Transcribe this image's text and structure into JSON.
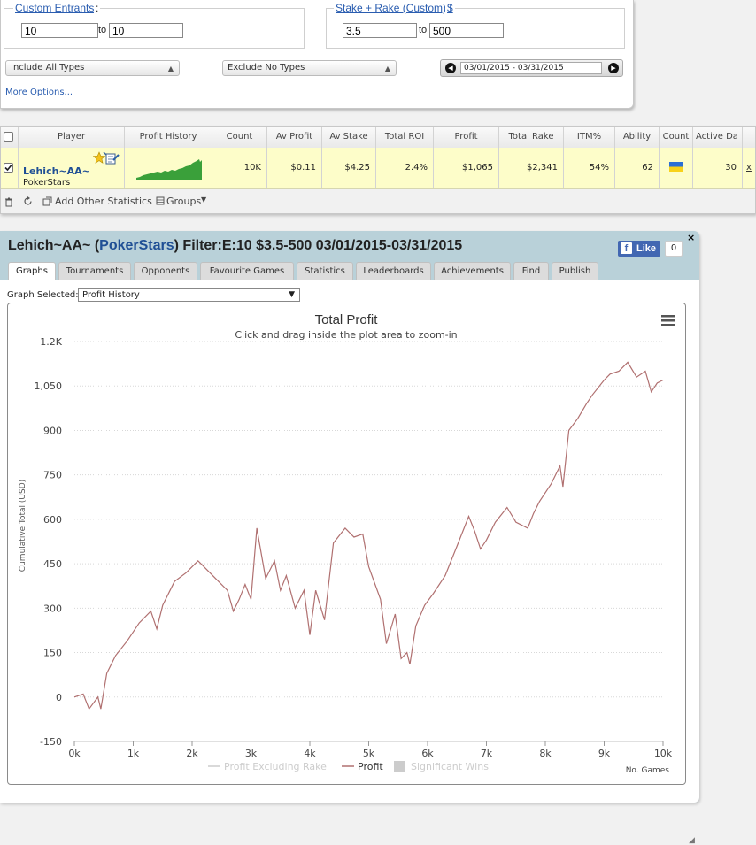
{
  "filters": {
    "entrants": {
      "legend": "Custom Entrants",
      "legend_colon": ":",
      "from": "10",
      "to_label": "to",
      "to": "10"
    },
    "stake": {
      "legend": "Stake + Rake (Custom)",
      "currency": "$",
      "from": "3.5",
      "to_label": "to",
      "to": "500"
    },
    "include_types": "Include All Types",
    "exclude_types": "Exclude No Types",
    "date_range": "03/01/2015 - 03/31/2015",
    "more_options": "More Options..."
  },
  "table": {
    "columns": [
      "Player",
      "Profit History",
      "Count",
      "Av Profit",
      "Av Stake",
      "Total ROI",
      "Profit",
      "Total Rake",
      "ITM%",
      "Ability",
      "Count",
      "Active Da"
    ],
    "row": {
      "player": "Lehich~AA~",
      "site": "PokerStars",
      "count": "10K",
      "av_profit": "$0.11",
      "av_stake": "$4.25",
      "total_roi": "2.4%",
      "profit": "$1,065",
      "total_rake": "$2,341",
      "itm": "54%",
      "ability": "62",
      "active_days": "30",
      "remove": "x"
    },
    "footer": {
      "add_stats": "Add Other Statistics",
      "groups": "Groups"
    }
  },
  "profile": {
    "player": "Lehich~AA~",
    "open_paren": "(",
    "site": "PokerStars",
    "filter_text": ") Filter:E:10 $3.5-500 03/01/2015-03/31/2015",
    "like_label": "Like",
    "like_count": "0",
    "close": "×",
    "tabs": [
      "Graphs",
      "Tournaments",
      "Opponents",
      "Favourite Games",
      "Statistics",
      "Leaderboards",
      "Achievements",
      "Find",
      "Publish"
    ],
    "active_tab": "Graphs",
    "graph_selected_label": "Graph Selected:",
    "graph_selected_value": "Profit History"
  },
  "colors": {
    "profit_line": "#b07070",
    "legend_disabled": "#cccccc",
    "link": "#1f4f95",
    "row_highlight": "#fdfdc9"
  },
  "chart_data": {
    "type": "line",
    "title": "Total Profit",
    "subtitle": "Click and drag inside the plot area to zoom-in",
    "ylabel": "Cumulative Total (USD)",
    "xlabel": "No. Games",
    "ylim": [
      -150,
      1200
    ],
    "xlim": [
      0,
      10000
    ],
    "y_ticks": [
      "-150",
      "0",
      "150",
      "300",
      "450",
      "600",
      "750",
      "900",
      "1,050",
      "1.2K"
    ],
    "y_tick_values": [
      -150,
      0,
      150,
      300,
      450,
      600,
      750,
      900,
      1050,
      1200
    ],
    "x_ticks": [
      "0k",
      "1k",
      "2k",
      "3k",
      "4k",
      "5k",
      "6k",
      "7k",
      "8k",
      "9k",
      "10k"
    ],
    "x_tick_values": [
      0,
      1000,
      2000,
      3000,
      4000,
      5000,
      6000,
      7000,
      8000,
      9000,
      10000
    ],
    "grid": true,
    "legend": [
      "Profit Excluding Rake",
      "Profit",
      "Significant Wins"
    ],
    "legend_position": "bottom",
    "series": [
      {
        "name": "Profit",
        "x": [
          0,
          150,
          250,
          400,
          450,
          550,
          700,
          900,
          1100,
          1300,
          1400,
          1500,
          1700,
          1900,
          2100,
          2300,
          2450,
          2600,
          2700,
          2800,
          2900,
          3000,
          3100,
          3250,
          3400,
          3500,
          3600,
          3750,
          3900,
          4000,
          4100,
          4250,
          4400,
          4600,
          4750,
          4900,
          5000,
          5200,
          5300,
          5450,
          5550,
          5650,
          5700,
          5800,
          5950,
          6100,
          6300,
          6500,
          6700,
          6800,
          6900,
          7000,
          7150,
          7350,
          7500,
          7700,
          7800,
          7900,
          8100,
          8250,
          8300,
          8400,
          8550,
          8700,
          8800,
          9000,
          9100,
          9250,
          9400,
          9550,
          9700,
          9800,
          9900,
          10000
        ],
        "y": [
          0,
          10,
          -40,
          0,
          -40,
          80,
          140,
          190,
          250,
          290,
          230,
          310,
          390,
          420,
          460,
          420,
          390,
          360,
          290,
          330,
          380,
          330,
          570,
          400,
          460,
          360,
          410,
          300,
          360,
          210,
          360,
          260,
          520,
          570,
          540,
          550,
          440,
          330,
          180,
          280,
          130,
          150,
          110,
          240,
          310,
          350,
          410,
          510,
          610,
          560,
          500,
          530,
          590,
          640,
          590,
          570,
          620,
          660,
          720,
          780,
          710,
          900,
          940,
          990,
          1020,
          1070,
          1090,
          1100,
          1130,
          1080,
          1100,
          1030,
          1060,
          1070
        ]
      }
    ]
  }
}
